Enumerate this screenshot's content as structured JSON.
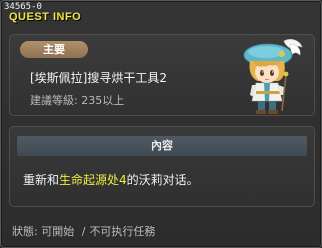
{
  "window": {
    "quest_id": "34565-0",
    "title": "QUEST INFO"
  },
  "quest": {
    "type_label": "主要",
    "name": "[埃斯佩拉]搜寻烘干工具2",
    "level_requirement": "建議等級: 235以上",
    "npc_icon": "npc-portrait-icon"
  },
  "content": {
    "header": "內容",
    "text_before": "重新和",
    "highlight": "生命起源处4",
    "text_after": "的沃莉对话。"
  },
  "status": {
    "label": "狀態:",
    "value_1": "可開始",
    "separator": "/",
    "value_2": "不可执行任務"
  },
  "colors": {
    "title_yellow": "#f0e64a",
    "highlight_yellow": "#f0ec40",
    "badge_brown": "#a08060"
  }
}
